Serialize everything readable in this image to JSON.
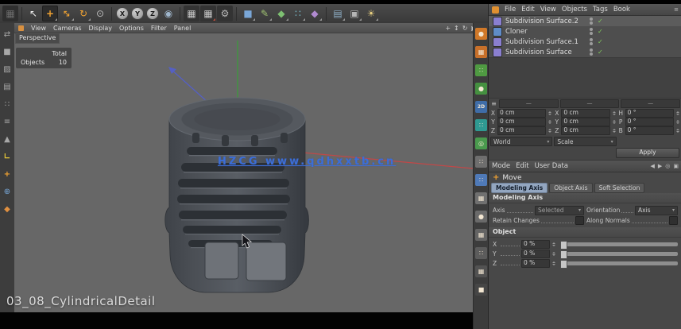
{
  "colors": {
    "accent_orange": "#f0a232",
    "check_green": "#82ca5c",
    "axis_green": "#3c9b3c",
    "axis_red": "#c04848",
    "axis_blue": "#5560c4",
    "watermark_blue": "#3c6ed6",
    "tab_active": "#93a6c0"
  },
  "toolbar": {
    "axis_lock": [
      "X",
      "Y",
      "Z"
    ],
    "two_d_label": "2D"
  },
  "viewport": {
    "menu": [
      "View",
      "Cameras",
      "Display",
      "Options",
      "Filter",
      "Panel"
    ],
    "camera_label": "Perspective",
    "hud": {
      "total_header": "Total",
      "objects_label": "Objects",
      "objects_value": "10"
    },
    "watermark": "HZCG www.qdhxxtb.cn",
    "caption": "03_08_CylindricalDetail"
  },
  "object_manager": {
    "menu": [
      "File",
      "Edit",
      "View",
      "Objects",
      "Tags",
      "Book"
    ],
    "items": [
      {
        "label": "Subdivision Surface.2"
      },
      {
        "label": "Cloner"
      },
      {
        "label": "Subdivision Surface.1"
      },
      {
        "label": "Subdivision Surface"
      }
    ]
  },
  "coordinates": {
    "headers": [
      "—",
      "—",
      "—"
    ],
    "position": [
      {
        "label": "X",
        "value": "0 cm"
      },
      {
        "label": "Y",
        "value": "0 cm"
      },
      {
        "label": "Z",
        "value": "0 cm"
      }
    ],
    "size": [
      {
        "label": "X",
        "value": "0 cm"
      },
      {
        "label": "Y",
        "value": "0 cm"
      },
      {
        "label": "Z",
        "value": "0 cm"
      }
    ],
    "rotation": [
      {
        "label": "H",
        "value": "0 °"
      },
      {
        "label": "P",
        "value": "0 °"
      },
      {
        "label": "B",
        "value": "0 °"
      }
    ],
    "space_dropdown": "World",
    "scale_dropdown": "Scale",
    "apply_button": "Apply"
  },
  "attributes": {
    "menu": [
      "Mode",
      "Edit",
      "User Data"
    ],
    "tool_title": "Move",
    "tabs": [
      "Modeling Axis",
      "Object Axis",
      "Soft Selection"
    ],
    "section_modeling": "Modeling Axis",
    "axis_label": "Axis",
    "axis_value": "Selected",
    "orientation_label": "Orientation",
    "orientation_value": "Axis",
    "retain_changes_label": "Retain Changes",
    "along_normals_label": "Along Normals",
    "section_object": "Object",
    "offsets": [
      {
        "label": "X",
        "value": "0 %"
      },
      {
        "label": "Y",
        "value": "0 %"
      },
      {
        "label": "Z",
        "value": "0 %"
      }
    ]
  }
}
